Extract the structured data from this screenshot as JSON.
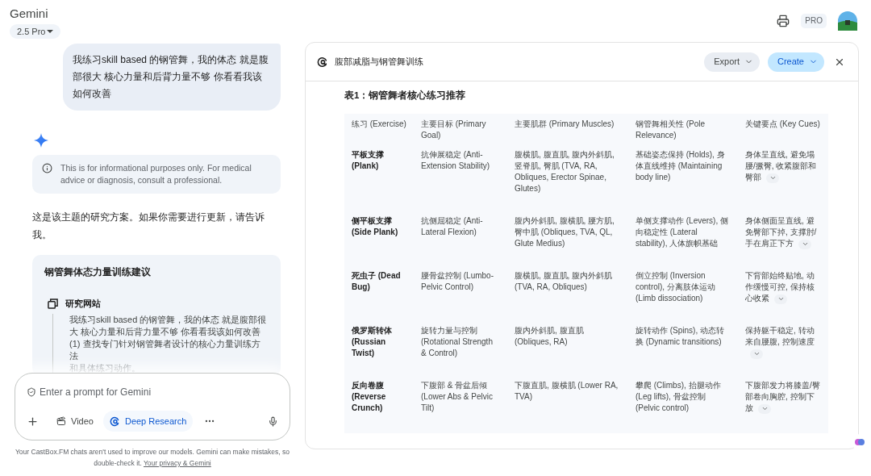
{
  "app": {
    "title": "Gemini",
    "model": "2.5 Pro",
    "badge": "PRO"
  },
  "chat": {
    "user_message": "我练习skill based 的钢管舞，我的体态 就是腹部很大 核心力量和后背力量不够 你看看我该如何改善",
    "disclaimer": "This is for informational purposes only. For medical advice or diagnosis, consult a professional.",
    "response": "这是该主题的研究方案。如果你需要进行更新，请告诉我。",
    "research_card": {
      "title": "钢管舞体态力量训练建议",
      "step_title": "研究网站",
      "step_lines": [
        "我练习skill based 的钢管舞，我的体态 就是腹部很大 核心力量和后背力量不够 你看看我该如何改善",
        "(1) 查找专门针对钢管舞者设计的核心力量训练方法",
        "和具体练习动作。"
      ]
    }
  },
  "prompt": {
    "placeholder": "Enter a prompt for Gemini",
    "tools": [
      {
        "label": "Video",
        "selected": false
      },
      {
        "label": "Deep Research",
        "selected": true
      }
    ]
  },
  "footer": {
    "text": "Your CastBox.FM chats aren't used to improve our models. Gemini can make mistakes, so double-check it.",
    "link": "Your privacy & Gemini"
  },
  "panel": {
    "title": "腹部减脂与钢管舞训练",
    "buttons": [
      {
        "label": "Export",
        "kind": "secondary"
      },
      {
        "label": "Create",
        "kind": "primary"
      }
    ],
    "table_title": "表1：钢管舞者核心练习推荐",
    "table": {
      "columns": [
        "练习 (Exercise)",
        "主要目标 (Primary Goal)",
        "主要肌群 (Primary Muscles)",
        "钢管舞相关性 (Pole Relevance)",
        "关键要点 (Key Cues)"
      ],
      "rows": [
        [
          "平板支撑 (Plank)",
          "抗伸展稳定 (Anti-Extension Stability)",
          "腹横肌, 腹直肌, 腹内外斜肌, 竖脊肌, 臀肌 (TVA, RA, Obliques, Erector Spinae, Glutes)",
          "基础姿态保持 (Holds), 身体直线维持 (Maintaining body line)",
          "身体呈直线, 避免塌腰/撅臀, 收紧腹部和臀部"
        ],
        [
          "侧平板支撑 (Side Plank)",
          "抗侧屈稳定 (Anti-Lateral Flexion)",
          "腹内外斜肌, 腹横肌, 腰方肌, 臀中肌 (Obliques, TVA, QL, Glute Medius)",
          "单侧支撑动作 (Levers), 侧向稳定性 (Lateral stability), 人体旗帜基础",
          "身体侧面呈直线, 避免臀部下掉, 支撑肘/手在肩正下方"
        ],
        [
          "死虫子 (Dead Bug)",
          "腰骨盆控制 (Lumbo-Pelvic Control)",
          "腹横肌, 腹直肌, 腹内外斜肌 (TVA, RA, Obliques)",
          "倒立控制 (Inversion control), 分离肢体运动 (Limb dissociation)",
          "下背部始终贴地, 动作缓慢可控, 保持核心收紧"
        ],
        [
          "俄罗斯转体 (Russian Twist)",
          "旋转力量与控制 (Rotational Strength & Control)",
          "腹内外斜肌, 腹直肌 (Obliques, RA)",
          "旋转动作 (Spins), 动态转换 (Dynamic transitions)",
          "保持躯干稳定, 转动来自腰腹, 控制速度"
        ],
        [
          "反向卷腹 (Reverse Crunch)",
          "下腹部 & 骨盆后倾 (Lower Abs & Pelvic Tilt)",
          "下腹直肌, 腹横肌 (Lower RA, TVA)",
          "攀爬 (Climbs), 抬腿动作 (Leg lifts), 骨盆控制 (Pelvic control)",
          "下腹部发力将膝盖/臀部卷向胸腔, 控制下放"
        ]
      ]
    }
  }
}
